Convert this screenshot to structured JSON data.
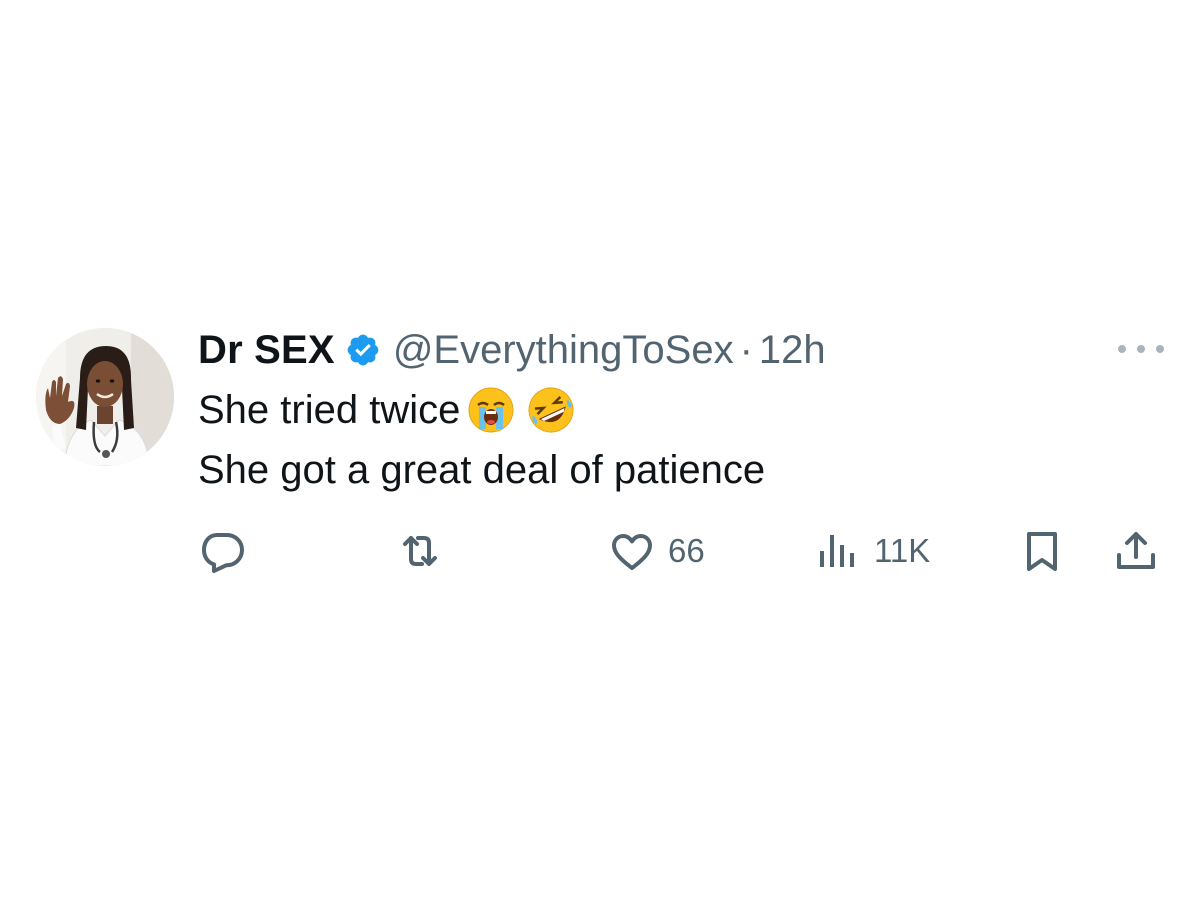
{
  "tweet": {
    "display_name": "Dr SEX",
    "handle": "@EverythingToSex",
    "separator": "·",
    "time": "12h",
    "lines": [
      "She tried twice",
      "She got a great deal of patience"
    ],
    "emojis": [
      "loudly-crying-face",
      "rolling-on-the-floor-laughing"
    ],
    "verified": true
  },
  "actions": {
    "reply_count": "",
    "retweet_count": "",
    "like_count": "66",
    "views_count": "11K"
  },
  "colors": {
    "text_primary": "#0f1419",
    "text_secondary": "#536471",
    "verified_blue": "#1d9bf0",
    "icon_gray": "#536471"
  },
  "icons": {
    "reply": "reply-icon",
    "retweet": "retweet-icon",
    "like": "heart-icon",
    "views": "views-icon",
    "bookmark": "bookmark-icon",
    "share": "share-icon",
    "more": "more-icon"
  }
}
